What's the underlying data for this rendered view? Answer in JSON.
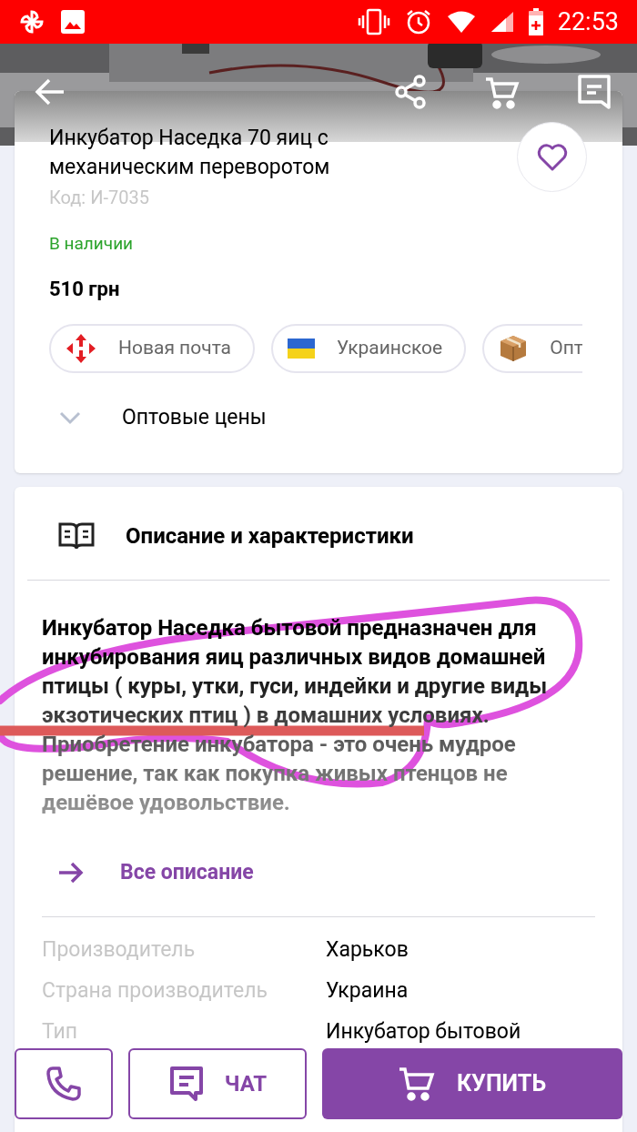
{
  "status_bar": {
    "time": "22:53"
  },
  "product": {
    "title": "Инкубатор Наседка 70 яиц с механическим переворотом",
    "code": "Код: И-7035",
    "availability": "В наличии",
    "in_stock": true,
    "favorite": false,
    "price": "510 грн",
    "chips": [
      {
        "kind": "post",
        "label": "Новая почта"
      },
      {
        "kind": "flag",
        "label": "Украинское"
      },
      {
        "kind": "box",
        "label": "Опт"
      }
    ],
    "wholesale": {
      "label": "Оптовые цены",
      "expanded": false
    }
  },
  "description": {
    "heading": "Описание и характеристики",
    "text": "Инкубатор Наседка бытовой предназначен для инкубирования яиц различных видов домашней птицы ( куры, утки, гуси, индейки и другие виды экзотических птиц ) в домашних условиях. Приобретение инкубатора - это очень мудрое решение, так как покупка живых птенцов не дешёвое удовольствие.",
    "more_link": "Все описание",
    "specs": [
      {
        "label": "Производитель",
        "value": "Харьков"
      },
      {
        "label": "Страна производитель",
        "value": "Украина"
      },
      {
        "label": "Тип",
        "value": "Инкубатор бытовой"
      }
    ]
  },
  "bottom_bar": {
    "chat": "ЧАТ",
    "buy": "КУПИТЬ"
  }
}
